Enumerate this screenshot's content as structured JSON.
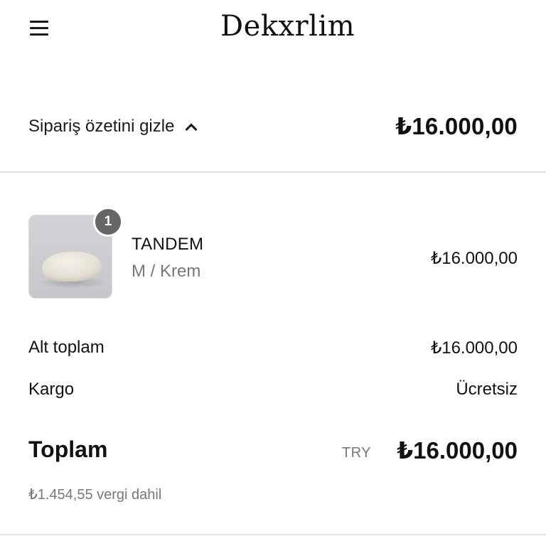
{
  "header": {
    "logo_text": "Dekxrlim",
    "menu_icon": "hamburger-menu-icon"
  },
  "summary_toggle": {
    "label": "Sipariş özetini gizle",
    "icon": "chevron-up-icon",
    "total": "₺16.000,00"
  },
  "line_items": [
    {
      "quantity": "1",
      "name": "TANDEM",
      "variant": "M / Krem",
      "price": "₺16.000,00"
    }
  ],
  "totals": {
    "subtotal_label": "Alt toplam",
    "subtotal_value": "₺16.000,00",
    "shipping_label": "Kargo",
    "shipping_value": "Ücretsiz",
    "total_label": "Toplam",
    "currency_code": "TRY",
    "total_value": "₺16.000,00",
    "tax_note": "₺1.454,55 vergi dahil"
  },
  "colors": {
    "text": "#111111",
    "muted": "#777777",
    "divider": "#e3e3e3",
    "badge": "#666666"
  }
}
